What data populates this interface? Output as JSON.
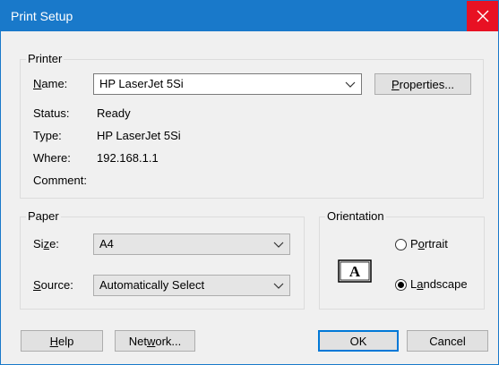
{
  "window": {
    "title": "Print Setup",
    "close_icon": "close-icon"
  },
  "printer": {
    "group_label": "Printer",
    "name_label_first": "N",
    "name_label_rest": "ame:",
    "name_value": "HP LaserJet 5Si",
    "properties_first": "P",
    "properties_rest": "roperties...",
    "status_label": "Status:",
    "status_value": "Ready",
    "type_label": "Type:",
    "type_value": "HP LaserJet 5Si",
    "where_label": "Where:",
    "where_value": "192.168.1.1",
    "comment_label": "Comment:"
  },
  "paper": {
    "group_label": "Paper",
    "size_label_first": "Si",
    "size_label_u": "z",
    "size_label_rest": "e:",
    "size_value": "A4",
    "source_label_first": "S",
    "source_label_rest": "ource:",
    "source_value": "Automatically Select"
  },
  "orientation": {
    "group_label": "Orientation",
    "portrait_first": "P",
    "portrait_u": "o",
    "portrait_rest": "rtrait",
    "landscape_first": "L",
    "landscape_u": "a",
    "landscape_rest": "ndscape",
    "selected": "Landscape",
    "icon_glyph": "A"
  },
  "buttons": {
    "help_first": "H",
    "help_rest": "elp",
    "network_first": "Net",
    "network_u": "w",
    "network_rest": "ork...",
    "ok": "OK",
    "cancel": "Cancel"
  },
  "colors": {
    "titlebar": "#1979ca",
    "close": "#e81123",
    "accent": "#0078d7"
  }
}
